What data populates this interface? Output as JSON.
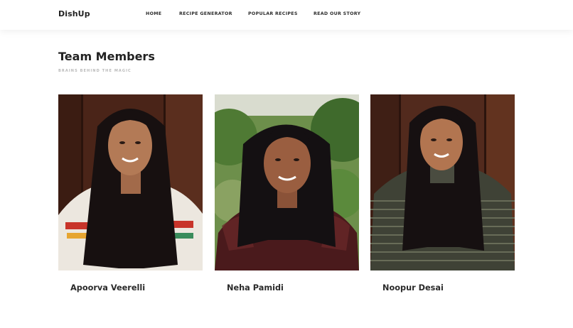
{
  "header": {
    "brand": "DishUp",
    "nav": [
      {
        "label": "HOME"
      },
      {
        "label": "RECIPE GENERATOR"
      },
      {
        "label": "POPULAR RECIPES"
      },
      {
        "label": "READ OUR STORY"
      }
    ]
  },
  "team": {
    "title": "Team Members",
    "subtitle": "BRAINS BEHIND THE MAGIC",
    "members": [
      {
        "name": "Apoorva Veerelli"
      },
      {
        "name": "Neha Pamidi"
      },
      {
        "name": "Noopur Desai"
      }
    ]
  }
}
